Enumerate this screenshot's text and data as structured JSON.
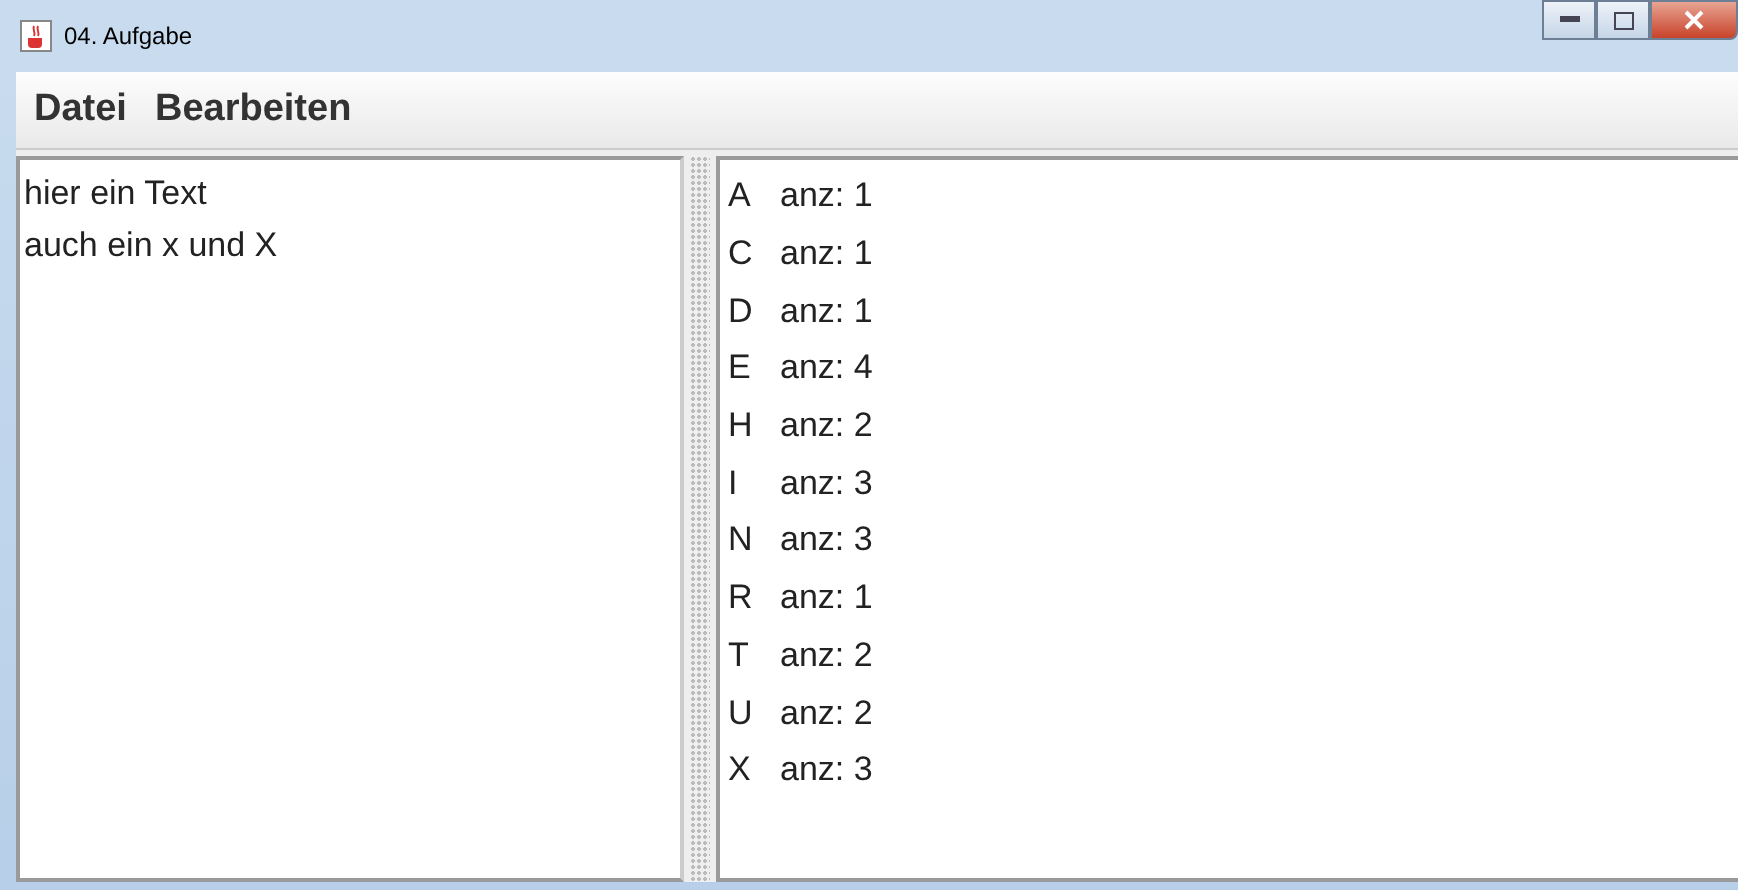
{
  "window": {
    "title": "04. Aufgabe"
  },
  "menu": [
    "Datei",
    "Bearbeiten"
  ],
  "left_text": [
    "hier ein Text",
    "auch ein x und X"
  ],
  "counts": [
    {
      "letter": "A",
      "count": "anz: 1"
    },
    {
      "letter": "C",
      "count": "anz: 1"
    },
    {
      "letter": "D",
      "count": "anz: 1"
    },
    {
      "letter": "E",
      "count": "anz: 4"
    },
    {
      "letter": "H",
      "count": "anz: 2"
    },
    {
      "letter": "I",
      "count": "anz: 3"
    },
    {
      "letter": "N",
      "count": "anz: 3"
    },
    {
      "letter": "R",
      "count": "anz: 1"
    },
    {
      "letter": "T",
      "count": "anz: 2"
    },
    {
      "letter": "U",
      "count": "anz: 2"
    },
    {
      "letter": "X",
      "count": "anz: 3"
    }
  ]
}
